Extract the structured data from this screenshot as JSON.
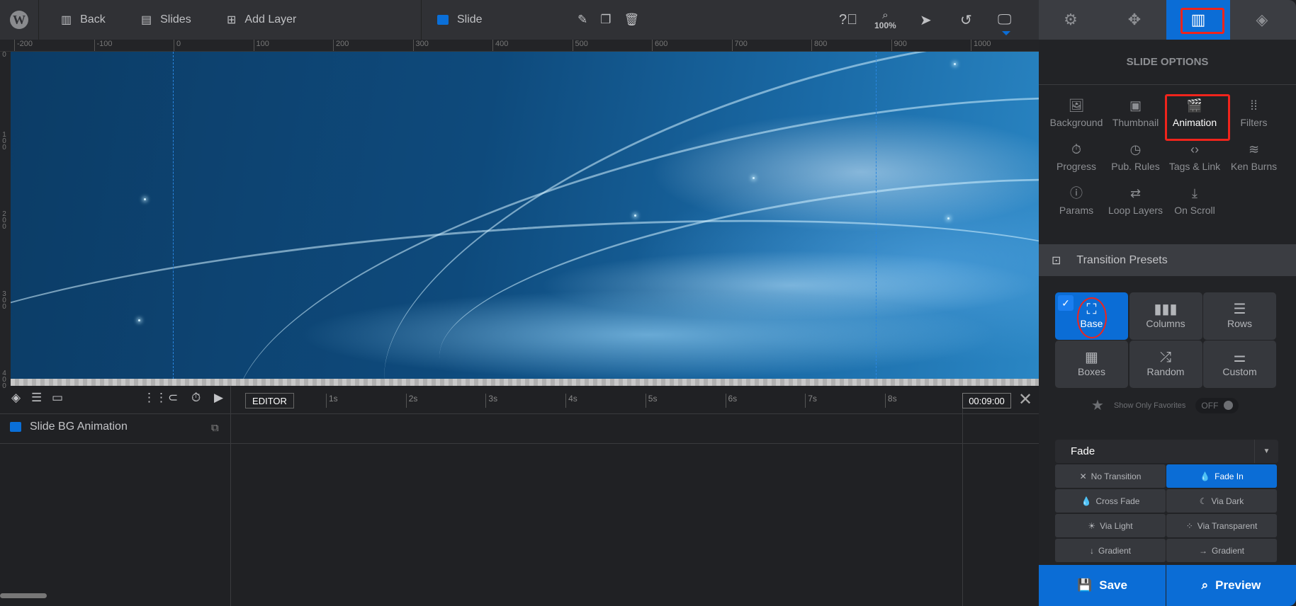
{
  "topbar": {
    "back": "Back",
    "slides": "Slides",
    "add_layer": "Add Layer",
    "slide": "Slide",
    "zoom": "100%"
  },
  "ruler": {
    "h": [
      "-200",
      "-100",
      "0",
      "100",
      "200",
      "300",
      "400",
      "500",
      "600",
      "700",
      "800",
      "900",
      "1000"
    ],
    "v": [
      "0",
      "100",
      "200",
      "300",
      "400"
    ]
  },
  "timeline": {
    "editor": "EDITOR",
    "seconds": [
      "1s",
      "2s",
      "3s",
      "4s",
      "5s",
      "6s",
      "7s",
      "8s"
    ],
    "duration": "00:09:00",
    "layer": "Slide BG Animation"
  },
  "panel": {
    "tabs": [
      "settings",
      "navigation",
      "slide",
      "layers"
    ],
    "title": "SLIDE OPTIONS",
    "options": [
      "Background",
      "Thumbnail",
      "Animation",
      "Filters",
      "Progress",
      "Pub. Rules",
      "Tags & Link",
      "Ken Burns",
      "Params",
      "Loop Layers",
      "On Scroll"
    ],
    "active_option": "Animation",
    "presets_title": "Transition Presets",
    "presets": [
      "Base",
      "Columns",
      "Rows",
      "Boxes",
      "Random",
      "Custom"
    ],
    "active_preset": "Base",
    "favorites_label": "Show Only Favorites",
    "favorites_toggle": "OFF",
    "group": "Fade",
    "transitions": [
      "No Transition",
      "Fade In",
      "Cross Fade",
      "Via Dark",
      "Via Light",
      "Via Transparent",
      "Gradient",
      "Gradient"
    ],
    "active_transition": "Fade In",
    "save": "Save",
    "preview": "Preview"
  },
  "colors": {
    "accent": "#0b6dd6",
    "highlight": "#f0241c"
  }
}
